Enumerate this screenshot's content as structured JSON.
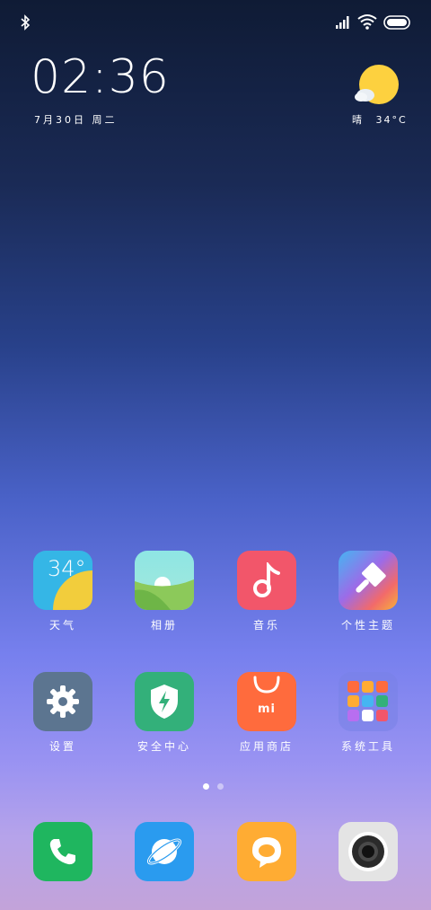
{
  "status_bar": {
    "icons": [
      "bluetooth-icon",
      "cell-signal-icon",
      "wifi-icon",
      "battery-icon"
    ]
  },
  "clock_widget": {
    "time": "02:36",
    "date": "7月30日 周二"
  },
  "weather_widget": {
    "condition": "晴",
    "temperature": "34°C",
    "icon": "sunny-cloud-icon"
  },
  "apps_row1": [
    {
      "label": "天气",
      "icon": "weather-app-icon",
      "badge_text": "34°"
    },
    {
      "label": "相册",
      "icon": "gallery-app-icon"
    },
    {
      "label": "音乐",
      "icon": "music-app-icon"
    },
    {
      "label": "个性主题",
      "icon": "themes-app-icon"
    }
  ],
  "apps_row2": [
    {
      "label": "设置",
      "icon": "settings-app-icon"
    },
    {
      "label": "安全中心",
      "icon": "security-app-icon"
    },
    {
      "label": "应用商店",
      "icon": "app-store-icon",
      "badge_text": "mi"
    },
    {
      "label": "系统工具",
      "icon": "system-tools-folder-icon"
    }
  ],
  "dock": [
    {
      "icon": "phone-app-icon"
    },
    {
      "icon": "browser-app-icon"
    },
    {
      "icon": "messages-app-icon"
    },
    {
      "icon": "camera-app-icon"
    }
  ],
  "page_indicator": {
    "total": 2,
    "current": 1
  },
  "colors": {
    "weather_tile": "#35b6e6",
    "gallery_tile": "#8ee0dd",
    "music_tile": "#f2566a",
    "settings_tile": "#5c7590",
    "security_tile": "#33b07a",
    "store_tile": "#ff6b3d",
    "phone_tile": "#1fb65f",
    "browser_tile": "#2a9bef",
    "messages_tile": "#ffac33",
    "camera_tile": "#e4e4e4"
  }
}
